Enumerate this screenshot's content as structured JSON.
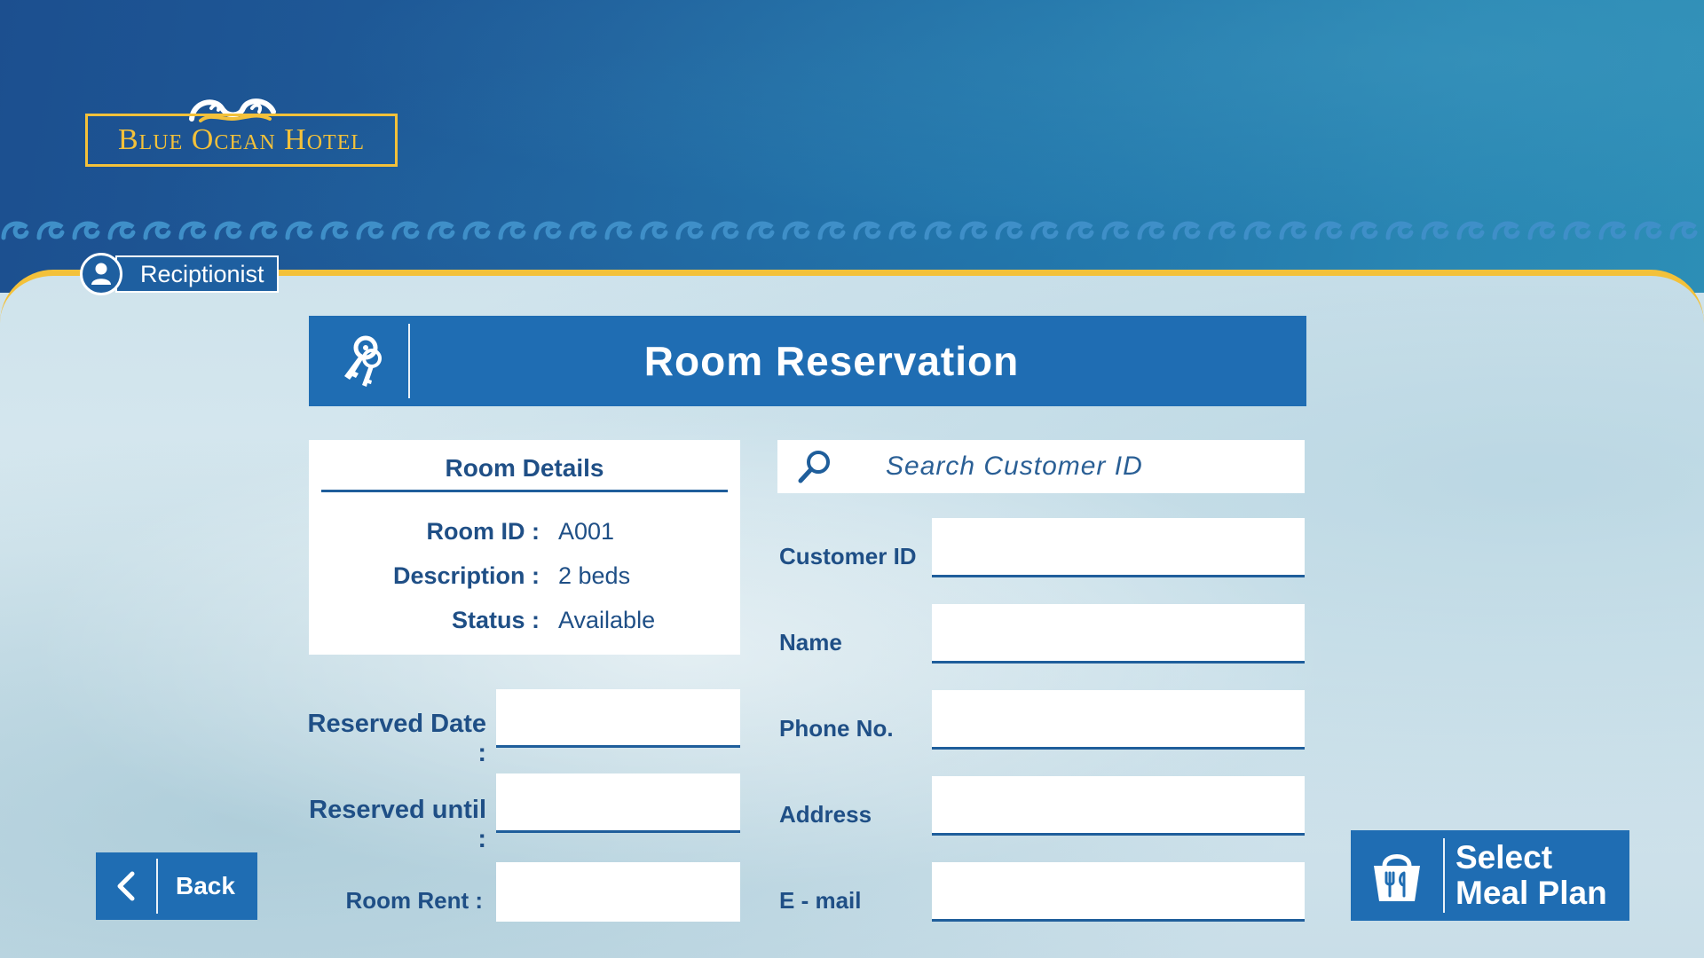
{
  "brand": {
    "name": "Blue Ocean Hotel"
  },
  "user": {
    "role": "Reciptionist"
  },
  "page": {
    "title": "Room Reservation"
  },
  "room_details": {
    "heading": "Room Details",
    "room_id_label": "Room ID :",
    "room_id": "A001",
    "description_label": "Description :",
    "description": "2 beds",
    "status_label": "Status :",
    "status": "Available"
  },
  "reservation": {
    "reserved_date_label": "Reserved Date :",
    "reserved_date": "",
    "reserved_until_label": "Reserved until :",
    "reserved_until": "",
    "room_rent_label": "Room Rent :",
    "room_rent": ""
  },
  "search": {
    "placeholder": "Search Customer ID",
    "value": ""
  },
  "customer": {
    "customer_id_label": "Customer ID",
    "customer_id": "",
    "name_label": "Name",
    "name": "",
    "phone_label": "Phone No.",
    "phone": "",
    "address_label": "Address",
    "address": "",
    "email_label": "E - mail",
    "email": ""
  },
  "buttons": {
    "back": "Back",
    "meal_line1": "Select",
    "meal_line2": "Meal Plan"
  },
  "colors": {
    "primary": "#1f6db3",
    "accent": "#f3c13a",
    "text": "#1f4f86"
  },
  "icons": {
    "title": "keys-icon",
    "search": "search-icon",
    "user": "user-icon",
    "back": "chevron-left-icon",
    "meal": "meal-basket-icon",
    "logo": "wave-swirl-icon"
  }
}
